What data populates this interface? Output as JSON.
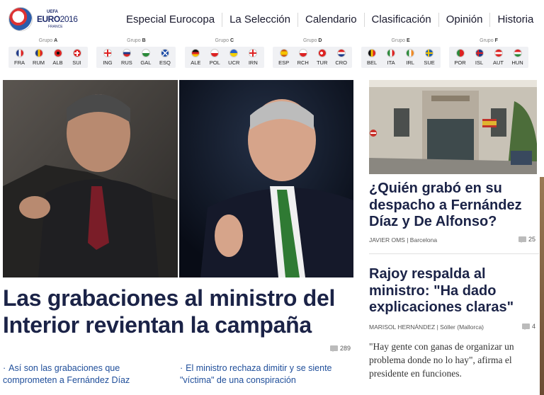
{
  "logo": {
    "uefa": "UEFA",
    "euro": "EURO",
    "year": "2016",
    "country": "FRANCE"
  },
  "nav": [
    "Especial Eurocopa",
    "La Selección",
    "Calendario",
    "Clasificación",
    "Opinión",
    "Historia"
  ],
  "group_prefix": "Grupo",
  "groups": [
    {
      "letter": "A",
      "teams": [
        "FRA",
        "RUM",
        "ALB",
        "SUI"
      ]
    },
    {
      "letter": "B",
      "teams": [
        "ING",
        "RUS",
        "GAL",
        "ESQ"
      ]
    },
    {
      "letter": "C",
      "teams": [
        "ALE",
        "POL",
        "UCR",
        "IRN"
      ]
    },
    {
      "letter": "D",
      "teams": [
        "ESP",
        "RCH",
        "TUR",
        "CRO"
      ]
    },
    {
      "letter": "E",
      "teams": [
        "BEL",
        "ITA",
        "IRL",
        "SUE"
      ]
    },
    {
      "letter": "F",
      "teams": [
        "POR",
        "ISL",
        "AUT",
        "HUN"
      ]
    }
  ],
  "main": {
    "headline": "Las grabaciones al ministro del Interior revientan la campaña",
    "comments": "289",
    "related": [
      "Así son las grabaciones que comprometen a Fernández Díaz",
      "El ministro rechaza dimitir y se siente \"víctima\" de una conspiración"
    ]
  },
  "side": [
    {
      "headline": "¿Quién grabó en su despacho a Fernández Díaz y De Alfonso?",
      "author": "Javier Oms",
      "location": "Barcelona",
      "comments": "25"
    },
    {
      "headline": "Rajoy respalda al ministro: \"Ha dado explicaciones claras\"",
      "author": "Marisol Hernández",
      "location": "Sóller (Mallorca)",
      "comments": "4",
      "quote": "\"Hay gente con ganas de organizar un problema donde no lo hay\", afirma el presidente en funciones."
    }
  ],
  "colors": {
    "headline": "#1b2347",
    "link": "#1f4e9a",
    "group_bg": "#f0f1f4"
  }
}
